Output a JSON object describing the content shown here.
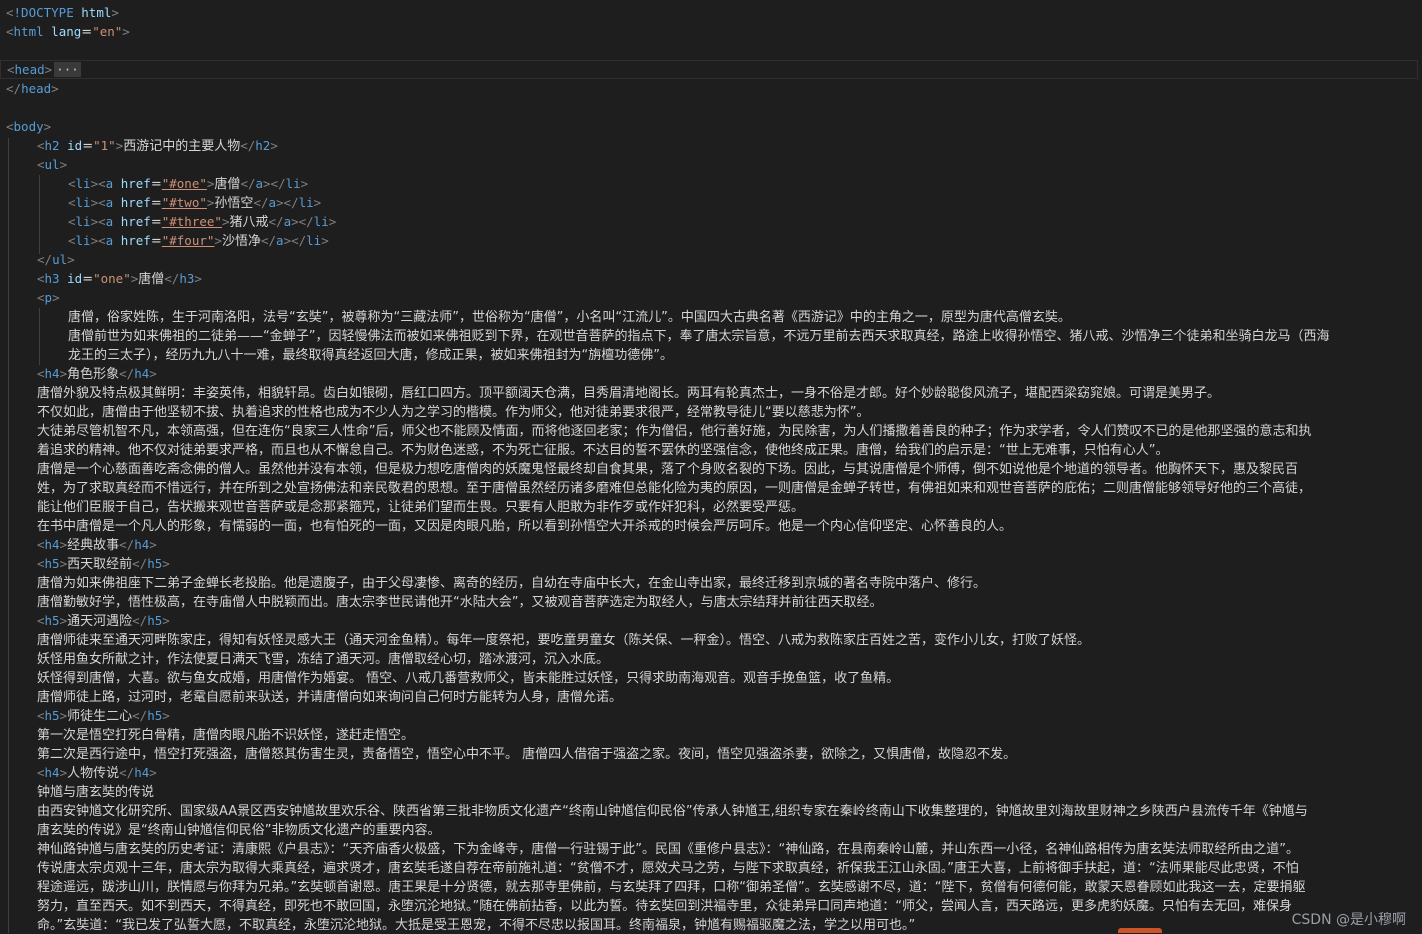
{
  "doc": {
    "doctype": "!DOCTYPE",
    "doctype_html": "html",
    "html_tag": "html",
    "lang_attr": "lang",
    "lang_val": "\"en\"",
    "head_tag": "head",
    "fold_glyph": "···",
    "body_tag": "body"
  },
  "h2": {
    "tag": "h2",
    "attr": "id",
    "val": "\"1\"",
    "text": "西游记中的主要人物"
  },
  "ul": {
    "tag": "ul",
    "items": [
      {
        "href": "\"#one\"",
        "label": "唐僧"
      },
      {
        "href": "\"#two\"",
        "label": "孙悟空"
      },
      {
        "href": "\"#three\"",
        "label": "猪八戒"
      },
      {
        "href": "\"#four\"",
        "label": "沙悟净"
      }
    ]
  },
  "tags": {
    "li": "li",
    "a": "a",
    "href_attr": "href",
    "p": "p",
    "h4": "h4",
    "h5": "h5",
    "h3": "h3",
    "id_attr": "id"
  },
  "h3": {
    "val": "\"one\"",
    "text": "唐僧"
  },
  "p_lines": [
    "唐僧，俗家姓陈，生于河南洛阳，法号“玄奘”，被尊称为“三藏法师”，世俗称为“唐僧”，小名叫“江流儿”。中国四大古典名著《西游记》中的主角之一，原型为唐代高僧玄奘。",
    "唐僧前世为如来佛祖的二徒弟——“金蝉子”，因轻慢佛法而被如来佛祖贬到下界，在观世音菩萨的指点下，奉了唐太宗旨意，不远万里前去西天求取真经，路途上收得孙悟空、猪八戒、沙悟净三个徒弟和坐骑白龙马（西海",
    "龙王的三太子），经历九九八十一难，最终取得真经返回大唐，修成正果，被如来佛祖封为“旃檀功德佛”。"
  ],
  "h4_a": "角色形象",
  "role_lines": [
    "唐僧外貌及特点极其鲜明：丰姿英伟，相貌轩昂。齿白如银砌，唇红口四方。顶平额阔天仓满，目秀眉清地阁长。两耳有轮真杰士，一身不俗是才郎。好个妙龄聪俊风流子，堪配西梁窈窕娘。可谓是美男子。",
    "不仅如此，唐僧由于他坚韧不拔、执着追求的性格也成为不少人为之学习的楷模。作为师父，他对徒弟要求很严，经常教导徒儿“要以慈悲为怀”。",
    "大徒弟尽管机智不凡，本领高强，但在连伤“良家三人性命”后，师父也不能顾及情面，而将他逐回老家；作为僧侣，他行善好施，为民除害，为人们播撒着善良的种子；作为求学者，令人们赞叹不已的是他那坚强的意志和执",
    "着追求的精神。他不仅对徒弟要求严格，而且也从不懈怠自己。不为财色迷惑，不为死亡征服。不达目的誓不罢休的坚强信念，使他终成正果。唐僧，给我们的启示是：“世上无难事，只怕有心人”。",
    "唐僧是一个心慈面善吃斋念佛的僧人。虽然他并没有本领，但是极力想吃唐僧肉的妖魔鬼怪最终却自食其果，落了个身败名裂的下场。因此，与其说唐僧是个师傅，倒不如说他是个地道的领导者。他胸怀天下，惠及黎民百",
    "姓，为了求取真经而不惜远行，并在所到之处宣扬佛法和亲民敬君的思想。至于唐僧虽然经历诸多磨难但总能化险为夷的原因，一则唐僧是金蝉子转世，有佛祖如来和观世音菩萨的庇佑；二则唐僧能够领导好他的三个高徒，",
    "能让他们臣服于自己，告状搬来观世音菩萨或是念那紧箍咒，让徒弟们望而生畏。只要有人胆敢为非作歹或作奸犯科，必然要受严惩。",
    "在书中唐僧是一个凡人的形象，有懦弱的一面，也有怕死的一面，又因是肉眼凡胎，所以看到孙悟空大开杀戒的时候会严厉呵斥。他是一个内心信仰坚定、心怀善良的人。"
  ],
  "h4_b": "经典故事",
  "h5_a": "西天取经前",
  "story_a": [
    "唐僧为如来佛祖座下二弟子金蝉长老投胎。他是遗腹子，由于父母凄惨、离奇的经历，自幼在寺庙中长大，在金山寺出家，最终迁移到京城的著名寺院中落户、修行。",
    "唐僧勤敏好学，悟性极高，在寺庙僧人中脱颖而出。唐太宗李世民请他开“水陆大会”，又被观音菩萨选定为取经人，与唐太宗结拜并前往西天取经。"
  ],
  "h5_b": "通天河遇险",
  "story_b": [
    "唐僧师徒来至通天河畔陈家庄，得知有妖怪灵感大王（通天河金鱼精）。每年一度祭祀，要吃童男童女（陈关保、一秤金）。悟空、八戒为救陈家庄百姓之苦，变作小儿女，打败了妖怪。",
    "妖怪用鱼女所献之计，作法使夏日满天飞雪，冻结了通天河。唐僧取经心切，踏冰渡河，沉入水底。",
    "妖怪得到唐僧，大喜。欲与鱼女成婚，用唐僧作为婚宴。 悟空、八戒几番营救师父，皆未能胜过妖怪，只得求助南海观音。观音手挽鱼篮，收了鱼精。",
    "唐僧师徒上路，过河时，老鼋自愿前来驮送，并请唐僧向如来询问自己何时方能转为人身，唐僧允诺。"
  ],
  "h5_c": "师徒生二心",
  "story_c": [
    "第一次是悟空打死白骨精，唐僧肉眼凡胎不识妖怪，遂赶走悟空。",
    "第二次是西行途中，悟空打死强盗，唐僧怒其伤害生灵，责备悟空，悟空心中不平。 唐僧四人借宿于强盗之家。夜间，悟空见强盗杀妻，欲除之，又惧唐僧，故隐忍不发。"
  ],
  "h4_c": "人物传说",
  "legend": [
    "钟馗与唐玄奘的传说",
    "由西安钟馗文化研究所、国家级AA景区西安钟馗故里欢乐谷、陕西省第三批非物质文化遗产“终南山钟馗信仰民俗”传承人钟馗王,组织专家在秦岭终南山下收集整理的，钟馗故里刘海故里财神之乡陕西户县流传千年《钟馗与",
    "唐玄奘的传说》是“终南山钟馗信仰民俗”非物质文化遗产的重要内容。",
    "神仙路钟馗与唐玄奘的历史考证：清康熙《户县志》：“天齐庙香火极盛，下为金峰寺，唐僧一行驻锡于此”。民国《重修户县志》：“神仙路，在县南秦岭山麓，并山东西一小径，名神仙路相传为唐玄奘法师取经所由之道”。",
    "传说唐太宗贞观十三年，唐太宗为取得大乘真经，遍求贤才，唐玄奘毛遂自荐在帝前施礼道：“贫僧不才，愿效犬马之劳，与陛下求取真经，祈保我王江山永固。”唐王大喜，上前将御手扶起，道：“法师果能尽此忠贤，不怕",
    "程途遥远，跋涉山川，朕情愿与你拜为兄弟。”玄奘顿首谢恩。唐王果是十分贤德，就去那寺里佛前，与玄奘拜了四拜，口称“御弟圣僧”。玄奘感谢不尽，道：“陛下，贫僧有何德何能，敢蒙天恩眷顾如此我这一去，定要捐躯",
    "努力，直至西天。如不到西天，不得真经，即死也不敢回国，永堕沉沦地狱。”随在佛前拈香，以此为誓。待玄奘回到洪福寺里，众徒弟异口同声地道：“师父，尝闻人言，西天路远，更多虎豹妖魔。只怕有去无回，难保身",
    "命。”玄奘道：“我已发了弘誓大愿，不取真经，永堕沉沦地狱。大抵是受王恩宠，不得不尽忠以报国耳。终南福泉，钟馗有赐福驱魔之法，学之以用可也。”"
  ],
  "watermark": "CSDN @是小穆啊"
}
